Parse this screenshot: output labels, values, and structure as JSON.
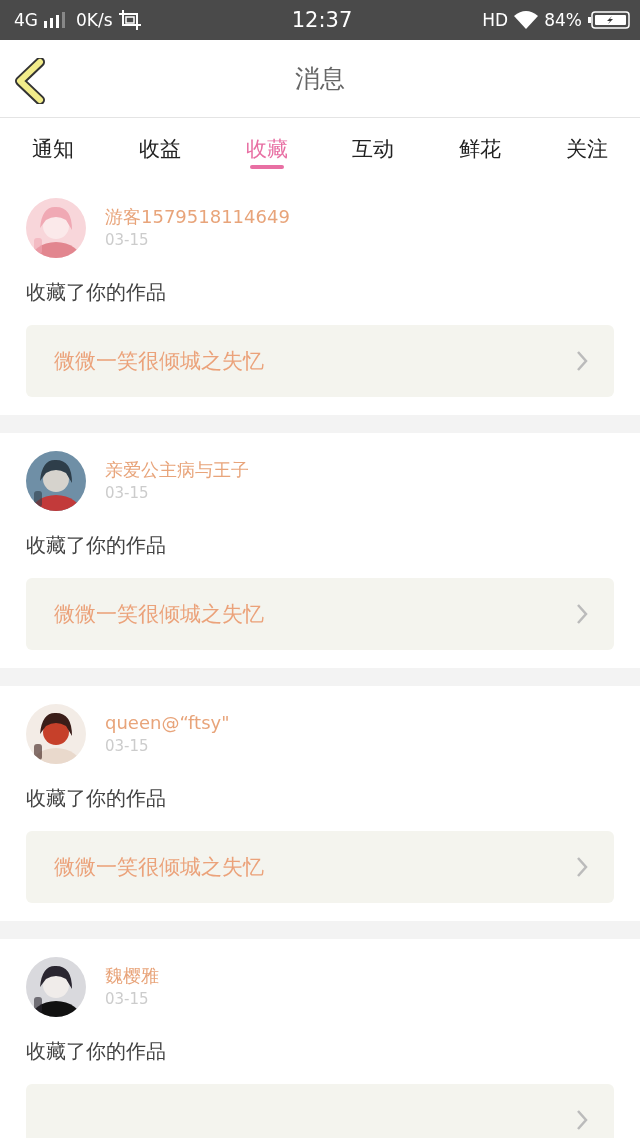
{
  "status_bar": {
    "network": "4G",
    "speed": "0K/s",
    "time": "12:37",
    "hd": "HD",
    "battery": "84%"
  },
  "header": {
    "title": "消息"
  },
  "tabs": [
    {
      "label": "通知",
      "selected": false
    },
    {
      "label": "收益",
      "selected": false
    },
    {
      "label": "收藏",
      "selected": true
    },
    {
      "label": "互动",
      "selected": false
    },
    {
      "label": "鲜花",
      "selected": false
    },
    {
      "label": "关注",
      "selected": false
    }
  ],
  "messages": [
    {
      "user": "游客1579518114649",
      "date": "03-15",
      "action": "收藏了你的作品",
      "work": "微微一笑很倾城之失忆"
    },
    {
      "user": "亲爱公主病与王子",
      "date": "03-15",
      "action": "收藏了你的作品",
      "work": "微微一笑很倾城之失忆"
    },
    {
      "user": "queen@“ftsy\"",
      "date": "03-15",
      "action": "收藏了你的作品",
      "work": "微微一笑很倾城之失忆"
    },
    {
      "user": "魏樱雅",
      "date": "03-15",
      "action": "收藏了你的作品"
    }
  ]
}
